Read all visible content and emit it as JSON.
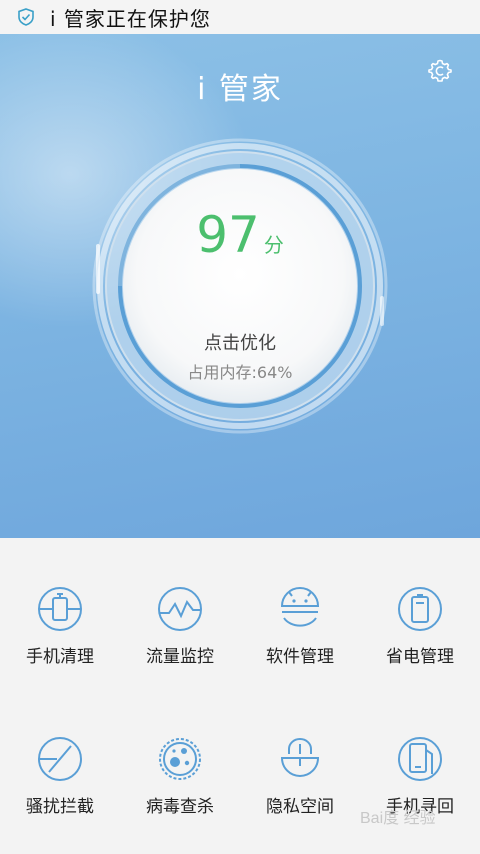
{
  "status_bar": {
    "text": "i 管家正在保护您",
    "icon": "shield-check-icon"
  },
  "header": {
    "title": "i 管家",
    "settings_icon": "gear-icon"
  },
  "score": {
    "value": "97",
    "unit": "分",
    "action": "点击优化",
    "memory_label": "占用内存:64%"
  },
  "features": [
    {
      "label": "手机清理",
      "icon": "broom-icon"
    },
    {
      "label": "流量监控",
      "icon": "traffic-chart-icon"
    },
    {
      "label": "软件管理",
      "icon": "android-icon"
    },
    {
      "label": "省电管理",
      "icon": "battery-icon"
    },
    {
      "label": "骚扰拦截",
      "icon": "block-icon"
    },
    {
      "label": "病毒查杀",
      "icon": "virus-icon"
    },
    {
      "label": "隐私空间",
      "icon": "lock-icon"
    },
    {
      "label": "手机寻回",
      "icon": "phone-find-icon"
    }
  ],
  "watermark": "Bai度 经验",
  "colors": {
    "accent": "#5a9fd6",
    "score_green": "#4cbf6e",
    "hero_blue": "#7eb5e2"
  }
}
